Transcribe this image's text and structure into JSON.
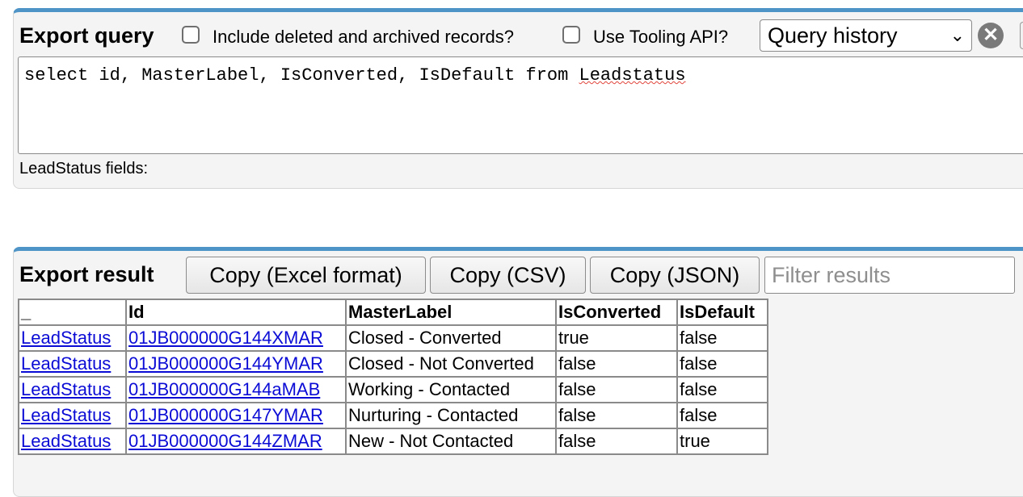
{
  "query_panel": {
    "title": "Export query",
    "include_deleted_label": "Include deleted and archived records?",
    "tooling_api_label": "Use Tooling API?",
    "history_select": "Query history",
    "query_text_before": "select id, MasterLabel, IsConverted, IsDefault from ",
    "query_text_misspelled": "Leadstatus",
    "fields_label": "LeadStatus fields:"
  },
  "result_panel": {
    "title": "Export result",
    "copy_excel_label": "Copy (Excel format)",
    "copy_csv_label": "Copy (CSV)",
    "copy_json_label": "Copy (JSON)",
    "filter_placeholder": "Filter results"
  },
  "table": {
    "headers": [
      "_",
      "Id",
      "MasterLabel",
      "IsConverted",
      "IsDefault"
    ],
    "rows": [
      [
        "LeadStatus",
        "01JB000000G144XMAR",
        "Closed - Converted",
        "true",
        "false"
      ],
      [
        "LeadStatus",
        "01JB000000G144YMAR",
        "Closed - Not Converted",
        "false",
        "false"
      ],
      [
        "LeadStatus",
        "01JB000000G144aMAB",
        "Working - Contacted",
        "false",
        "false"
      ],
      [
        "LeadStatus",
        "01JB000000G147YMAR",
        "Nurturing - Contacted",
        "false",
        "false"
      ],
      [
        "LeadStatus",
        "01JB000000G144ZMAR",
        "New - Not Contacted",
        "false",
        "true"
      ]
    ]
  },
  "icons": {
    "clear": "✕",
    "chevron": "⌄"
  },
  "colors": {
    "accent": "#4f94c6",
    "link": "#0b0bd6"
  }
}
